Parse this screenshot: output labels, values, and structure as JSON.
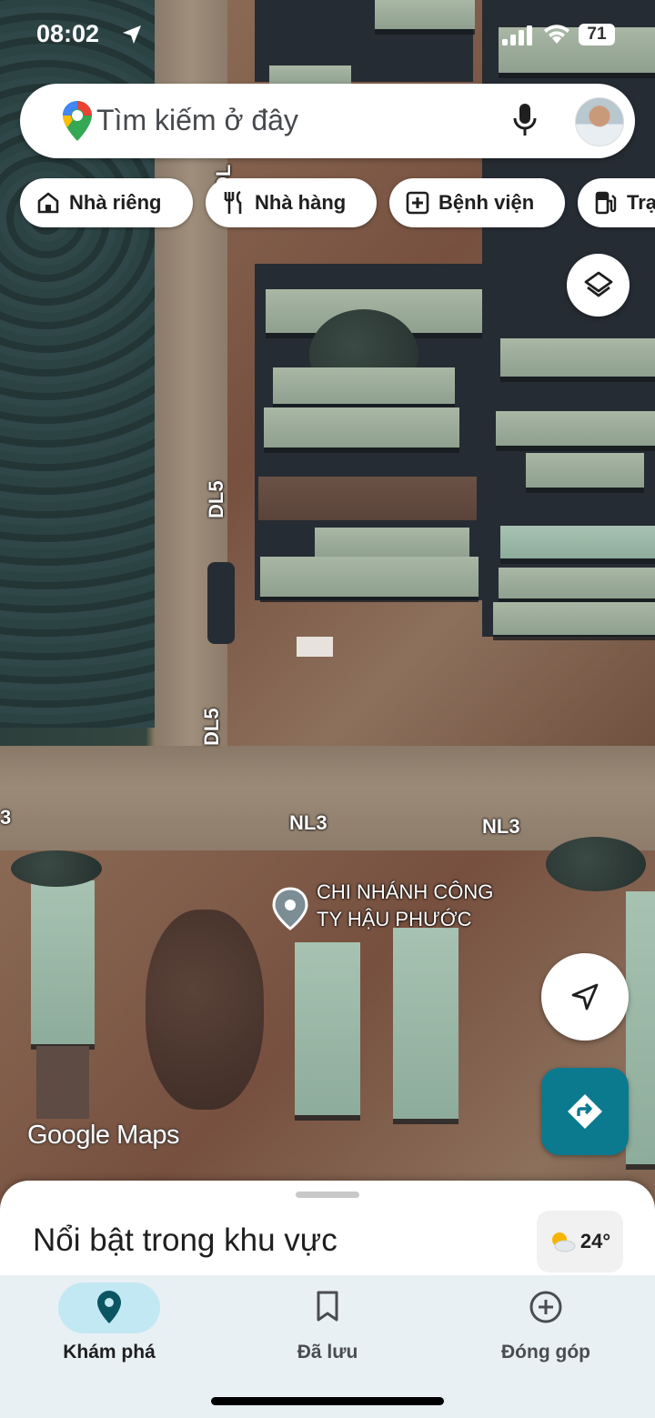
{
  "status_bar": {
    "time": "08:02",
    "battery": "71"
  },
  "search": {
    "placeholder": "Tìm kiếm ở đây"
  },
  "chips": [
    {
      "label": "Nhà riêng",
      "icon": "home-icon"
    },
    {
      "label": "Nhà hàng",
      "icon": "restaurant-icon"
    },
    {
      "label": "Bệnh viện",
      "icon": "hospital-icon"
    },
    {
      "label": "Trạ",
      "icon": "gas-station-icon"
    }
  ],
  "map": {
    "road_labels": {
      "dl5_top": "DL",
      "dl5_a": "DL5",
      "dl5_b": "DL5",
      "nl3_a": "NL3",
      "nl3_b": "NL3",
      "nl3_edge": "3"
    },
    "place": {
      "name_line1": "CHI NHÁNH CÔNG",
      "name_line2": "TY HẬU PHƯỚC"
    },
    "watermark": "Google Maps"
  },
  "sheet": {
    "title": "Nổi bật trong khu vực",
    "temperature": "24°"
  },
  "nav": {
    "items": [
      {
        "label": "Khám phá",
        "active": true
      },
      {
        "label": "Đã lưu",
        "active": false
      },
      {
        "label": "Đóng góp",
        "active": false
      }
    ]
  },
  "colors": {
    "active_nav": "#0b5563",
    "active_pill": "#c2e8f3",
    "directions": "#0b7a8f"
  }
}
